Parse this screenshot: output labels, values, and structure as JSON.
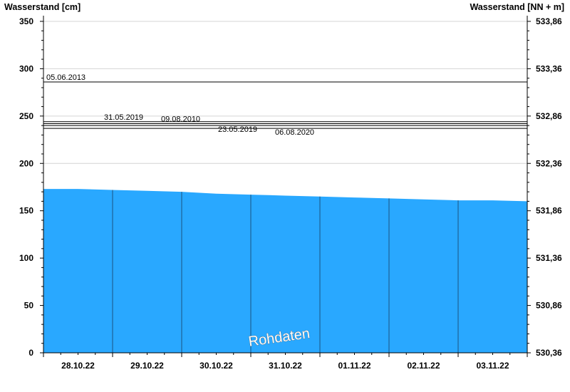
{
  "chart_data": {
    "type": "area",
    "ylabel_left": "Wasserstand [cm]",
    "ylabel_right": "Wasserstand [NN + m]",
    "ylim": [
      0,
      356
    ],
    "yticks_left": [
      0,
      50,
      100,
      150,
      200,
      250,
      300,
      350
    ],
    "yticks_right": [
      "530,36",
      "530,86",
      "531,36",
      "531,86",
      "532,36",
      "532,86",
      "533,36",
      "533,86"
    ],
    "x_categories": [
      "28.10.22",
      "29.10.22",
      "30.10.22",
      "31.10.22",
      "01.11.22",
      "02.11.22",
      "03.11.22"
    ],
    "x_range_days": [
      0,
      7
    ],
    "series": [
      {
        "x": [
          0,
          0.5,
          1.0,
          1.5,
          2.0,
          2.5,
          3.0,
          3.5,
          4.0,
          4.5,
          5.0,
          5.5,
          6.0,
          6.5,
          7.0
        ],
        "values": [
          173,
          173,
          172,
          171,
          170,
          168,
          167,
          166,
          165,
          164,
          163,
          162,
          161,
          161,
          160
        ]
      }
    ],
    "reference_lines": [
      {
        "date": "05.06.2013",
        "value": 286
      },
      {
        "date": "31.05.2019",
        "value": 244
      },
      {
        "date": "09.08.2010",
        "value": 242
      },
      {
        "date": "23.05.2019",
        "value": 240
      },
      {
        "date": "06.08.2020",
        "value": 237
      }
    ],
    "watermark": "Rohdaten",
    "colors": {
      "area": "#29a8ff",
      "grid": "#d4d4d4",
      "line": "#000000",
      "separator": "#1a5580"
    },
    "grid": true,
    "legend": "none"
  }
}
